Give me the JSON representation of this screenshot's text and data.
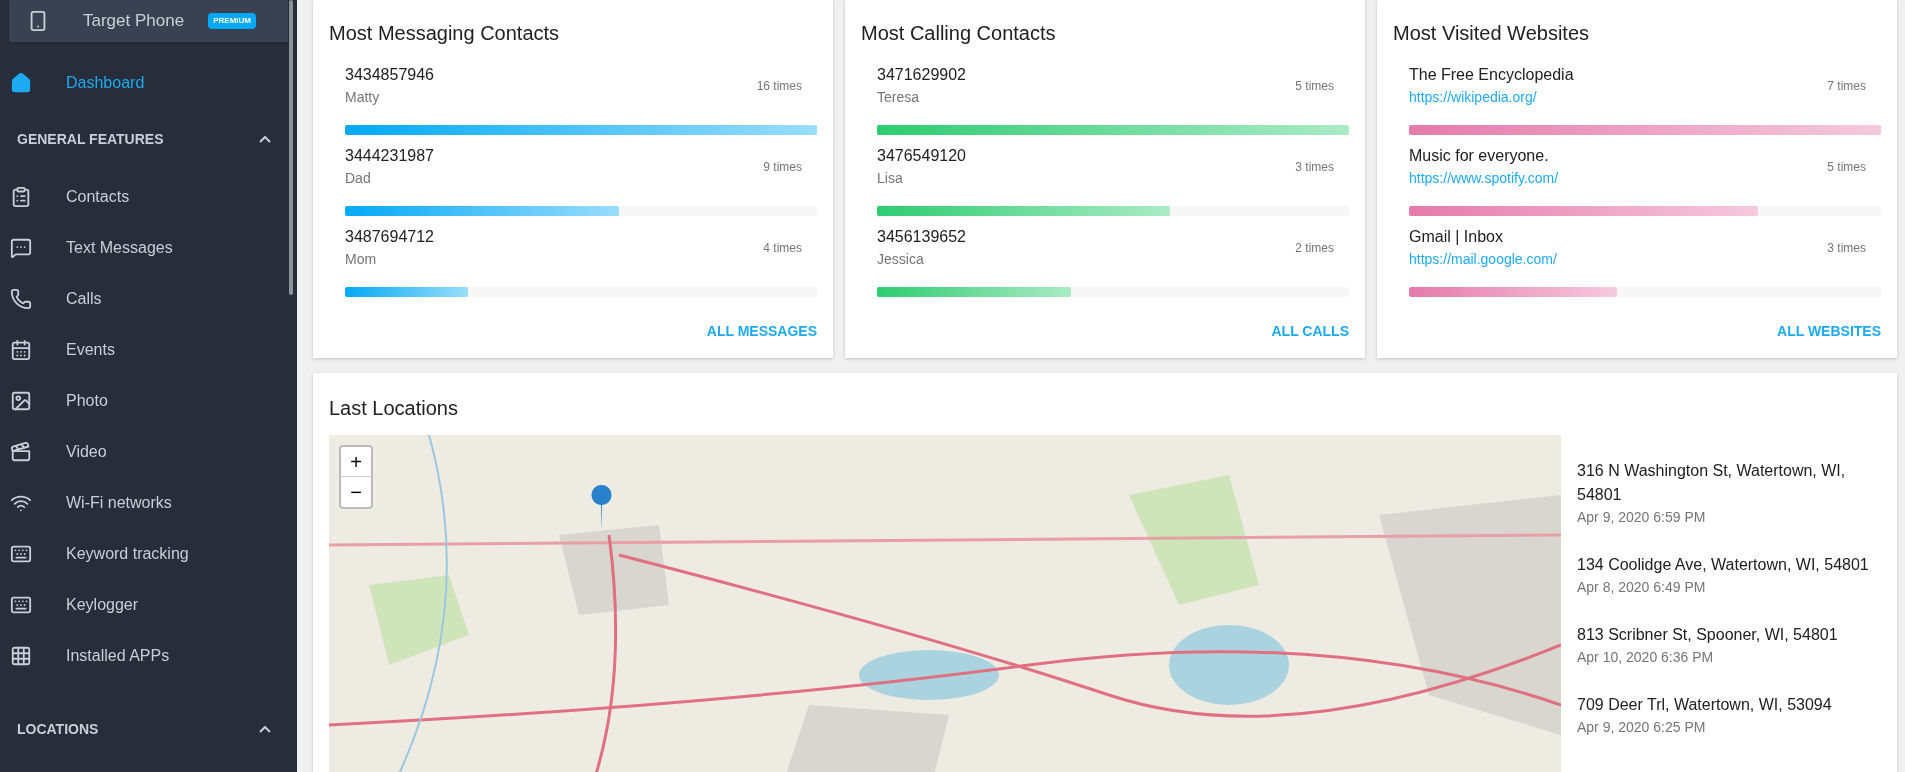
{
  "device": {
    "name": "Target Phone",
    "badge": "PREMIUM"
  },
  "sidebar": [
    {
      "kind": "item",
      "label": "Dashboard",
      "selected": true
    },
    {
      "kind": "section",
      "label": "GENERAL FEATURES",
      "expanded": true,
      "items": [
        {
          "label": "Contacts",
          "selected": false
        },
        {
          "label": "Text Messages",
          "selected": false
        },
        {
          "label": "Calls",
          "selected": false
        },
        {
          "label": "Events",
          "selected": false
        },
        {
          "label": "Photo",
          "selected": false
        },
        {
          "label": "Video",
          "selected": false
        },
        {
          "label": "Wi-Fi networks",
          "selected": false
        },
        {
          "label": "Keyword tracking",
          "selected": false
        },
        {
          "label": "Keylogger",
          "selected": false
        },
        {
          "label": "Installed APPs",
          "selected": false
        }
      ]
    },
    {
      "kind": "section",
      "label": "LOCATIONS",
      "expanded": true
    }
  ],
  "cards": [
    {
      "title": "Most Messaging Contacts",
      "kind": "contacts",
      "color": "#03a9f4",
      "link": "ALL MESSAGES",
      "rows": [
        {
          "primary": "3434857946",
          "secondary": "Matty",
          "count": "16 times",
          "level": 1
        },
        {
          "primary": "3444231987",
          "secondary": "Dad",
          "count": "9 times",
          "level": 0.58
        },
        {
          "primary": "3487694712",
          "secondary": "Mom",
          "count": "4 times",
          "level": 0.26
        }
      ]
    },
    {
      "title": "Most Calling Contacts",
      "kind": "contacts",
      "color": "#2ecc71",
      "link": "ALL CALLS",
      "rows": [
        {
          "primary": "3471629902",
          "secondary": "Teresa",
          "count": "5 times",
          "level": 1
        },
        {
          "primary": "3476549120",
          "secondary": "Lisa",
          "count": "3 times",
          "level": 0.62
        },
        {
          "primary": "3456139652",
          "secondary": "Jessica",
          "count": "2 times",
          "level": 0.41
        }
      ]
    },
    {
      "title": "Most Visited Websites",
      "color": "#e57aab",
      "link": "ALL WEBSITES",
      "kind": "websites",
      "rows": [
        {
          "primary": "The Free Encyclopedia",
          "secondary": "https://wikipedia.org/",
          "count": "7 times",
          "level": 1
        },
        {
          "primary": "Music for everyone.",
          "secondary": "https://www.spotify.com/",
          "count": "5 times",
          "level": 0.74
        },
        {
          "primary": "Gmail | Inbox",
          "secondary": "https://mail.google.com/",
          "count": "3 times",
          "level": 0.44
        }
      ]
    }
  ],
  "locations": {
    "title": "Last Locations",
    "zoom": [
      "+",
      "−"
    ],
    "items": [
      {
        "address": "316 N Washington St, Watertown, WI, 54801",
        "time": "Apr 9, 2020 6:59 PM"
      },
      {
        "address": "134 Coolidge Ave, Watertown, WI, 54801",
        "time": "Apr 8, 2020 6:49 PM"
      },
      {
        "address": "813 Scribner St, Spooner, WI, 54801",
        "time": "Apr 10, 2020 6:36 PM"
      },
      {
        "address": "709 Deer Trl, Watertown, WI, 53094",
        "time": "Apr 9, 2020 6:25 PM"
      }
    ]
  }
}
